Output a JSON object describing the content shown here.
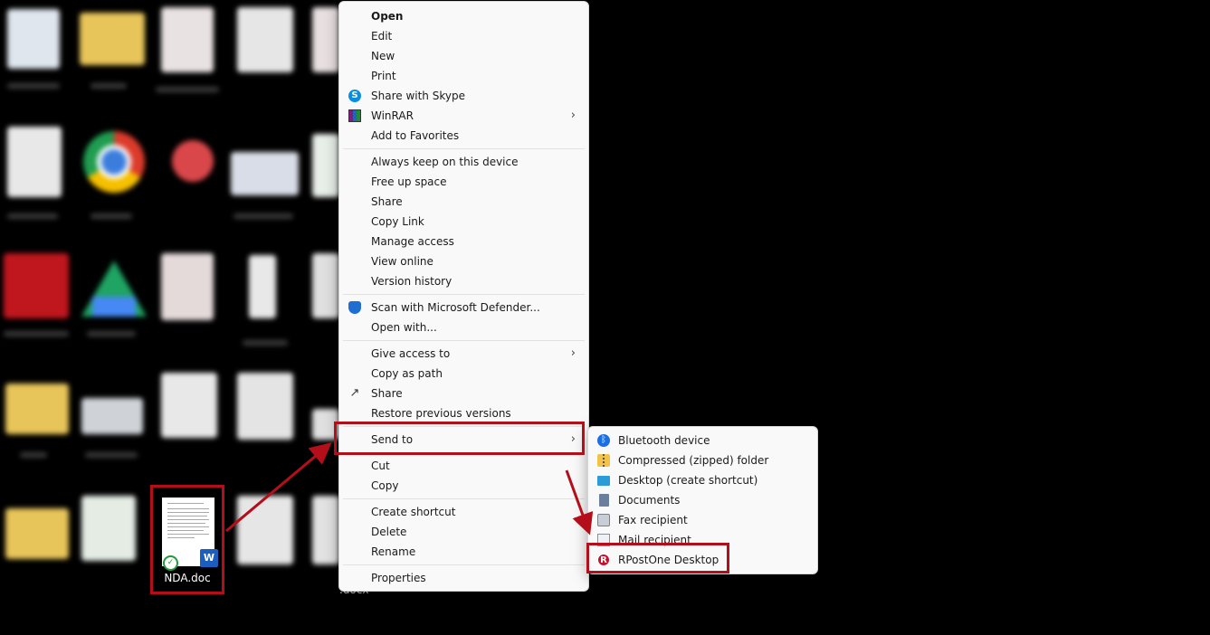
{
  "desktop": {
    "file_label": "NDA.doc",
    "partial_label": ".docx"
  },
  "context_menu": {
    "items": [
      {
        "label": "Open",
        "icon": ""
      },
      {
        "label": "Edit",
        "icon": ""
      },
      {
        "label": "New",
        "icon": ""
      },
      {
        "label": "Print",
        "icon": ""
      },
      {
        "label": "Share with Skype",
        "icon": "skype-icon"
      },
      {
        "label": "WinRAR",
        "icon": "winrar-icon",
        "submenu": true
      },
      {
        "label": "Add to Favorites",
        "icon": ""
      },
      {
        "label": "Always keep on this device",
        "icon": ""
      },
      {
        "label": "Free up space",
        "icon": ""
      },
      {
        "label": "Share",
        "icon": ""
      },
      {
        "label": "Copy Link",
        "icon": ""
      },
      {
        "label": "Manage access",
        "icon": ""
      },
      {
        "label": "View online",
        "icon": ""
      },
      {
        "label": "Version history",
        "icon": ""
      },
      {
        "label": "Scan with Microsoft Defender...",
        "icon": "shield-icon"
      },
      {
        "label": "Open with...",
        "icon": ""
      },
      {
        "label": "Give access to",
        "icon": "",
        "submenu": true
      },
      {
        "label": "Copy as path",
        "icon": ""
      },
      {
        "label": "Share",
        "icon": "share-icon"
      },
      {
        "label": "Restore previous versions",
        "icon": ""
      },
      {
        "label": "Send to",
        "icon": "",
        "submenu": true
      },
      {
        "label": "Cut",
        "icon": ""
      },
      {
        "label": "Copy",
        "icon": ""
      },
      {
        "label": "Create shortcut",
        "icon": ""
      },
      {
        "label": "Delete",
        "icon": ""
      },
      {
        "label": "Rename",
        "icon": ""
      },
      {
        "label": "Properties",
        "icon": ""
      }
    ],
    "chevron": "›"
  },
  "send_to_menu": {
    "items": [
      {
        "label": "Bluetooth device",
        "icon": "bluetooth-icon"
      },
      {
        "label": "Compressed (zipped) folder",
        "icon": "zip-folder-icon"
      },
      {
        "label": "Desktop (create shortcut)",
        "icon": "desktop-icon"
      },
      {
        "label": "Documents",
        "icon": "documents-icon"
      },
      {
        "label": "Fax recipient",
        "icon": "fax-icon"
      },
      {
        "label": "Mail recipient",
        "icon": "mail-icon"
      },
      {
        "label": "RPostOne Desktop",
        "icon": "rpost-icon"
      }
    ]
  },
  "colors": {
    "highlight_border": "#b30e1a",
    "menu_background": "#f9f9f9",
    "desktop_background": "#000000"
  },
  "glyphs": {
    "skype": "S",
    "bluetooth": "ᛒ",
    "rpost": "R",
    "word": "W",
    "check": "✓",
    "share": "↗"
  }
}
